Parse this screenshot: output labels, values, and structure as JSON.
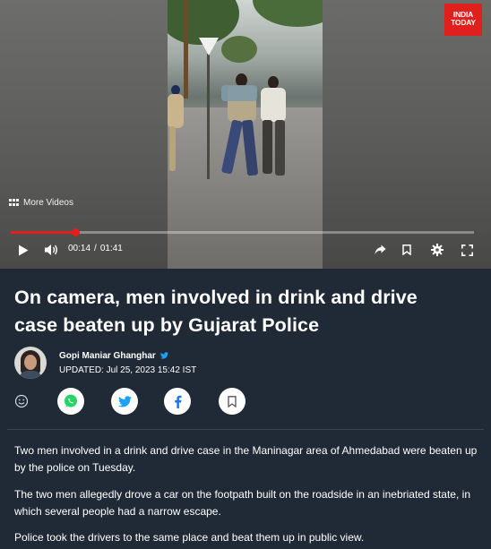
{
  "video": {
    "brand_logo": "INDIA TODAY",
    "more_videos_label": "More Videos",
    "current_time": "00:14",
    "time_separator": "/",
    "duration": "01:41",
    "progress_fraction": 0.1386,
    "accent_color": "#e0201c",
    "icons": [
      "play-icon",
      "volume-icon",
      "share-arrow-icon",
      "bookmark-icon",
      "settings-gear-icon",
      "fullscreen-icon"
    ]
  },
  "article": {
    "headline": "On camera, men involved in drink and drive case beaten up by Gujarat Police",
    "author_name": "Gopi Maniar Ghanghar",
    "updated": "UPDATED: Jul 25, 2023 15:42 IST",
    "share_icons": [
      "smiley-icon",
      "whatsapp-icon",
      "twitter-icon",
      "facebook-icon",
      "bookmark-icon"
    ],
    "paragraphs": [
      "Two men involved in a drink and drive case in the Maninagar area of Ahmedabad were beaten up by the police on Tuesday.",
      "The two men allegedly drove a car on the footpath built on the roadside in an inebriated state, in which several people had a narrow escape.",
      "Police took the drivers to the same place and beat them up in public view."
    ]
  },
  "colors": {
    "background": "#1f2a36",
    "twitter_blue": "#1da1f2",
    "whatsapp_green": "#25d366",
    "facebook_blue": "#1877f2"
  }
}
